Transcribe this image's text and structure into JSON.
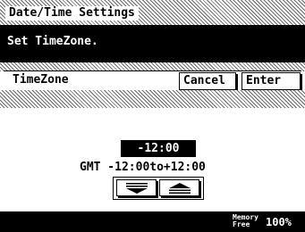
{
  "header": {
    "title": "Date/Time Settings"
  },
  "message": "Set TimeZone.",
  "panel": {
    "label": "TimeZone",
    "cancel_label": "Cancel",
    "enter_label": "Enter"
  },
  "timezone": {
    "value": "-12:00",
    "range_text": "GMT -12:00to+12:00"
  },
  "stepper": {
    "down_icon": "triangle-down-with-bars",
    "up_icon": "triangle-up-with-bars"
  },
  "status": {
    "memory_line1": "Memory",
    "memory_line2": "Free",
    "memory_value": "100%"
  }
}
